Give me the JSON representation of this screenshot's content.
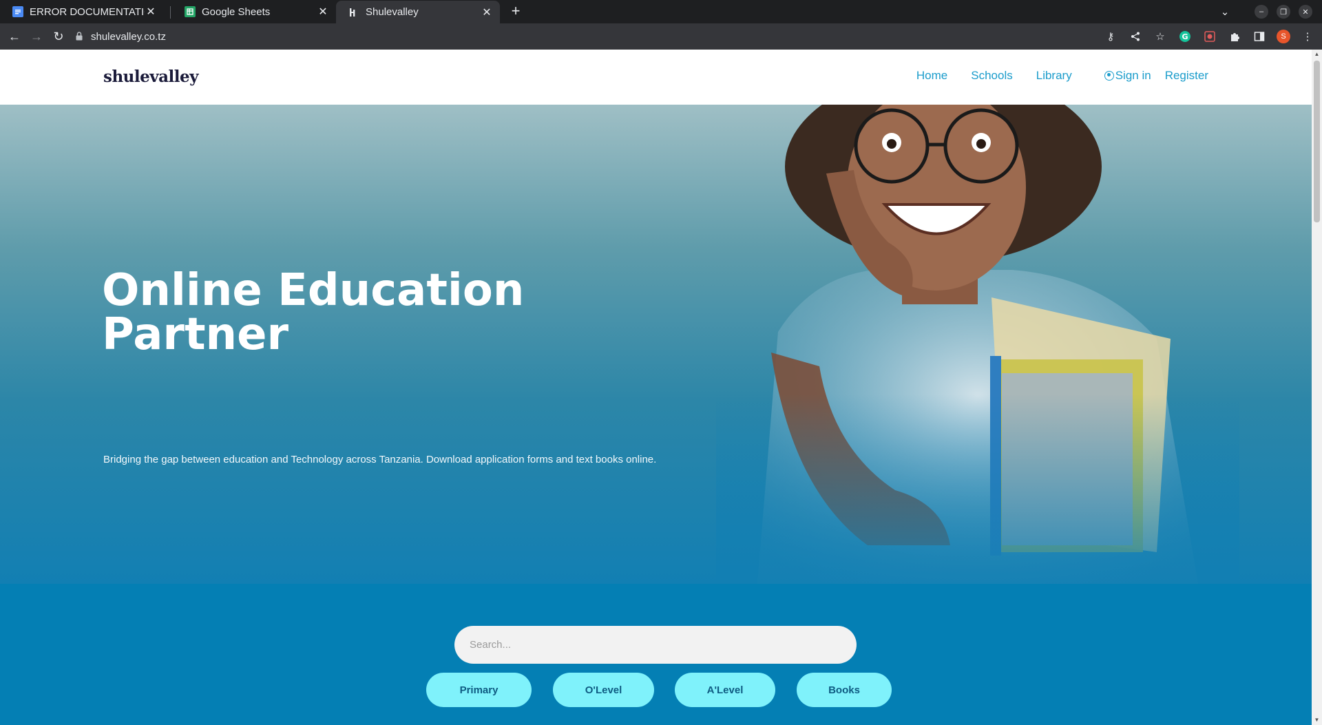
{
  "browser": {
    "tabs": [
      {
        "title": "ERROR DOCUMENTATION"
      },
      {
        "title": "Google Sheets"
      },
      {
        "title": "Shulevalley"
      }
    ],
    "url": "shulevalley.co.tz",
    "profile_initial": "S"
  },
  "site": {
    "brand": "shulevalley",
    "nav": {
      "home": "Home",
      "schools": "Schools",
      "library": "Library",
      "signin": "Sign in",
      "register": "Register"
    }
  },
  "hero": {
    "title_line1": "Online Education",
    "title_line2": "Partner",
    "subtitle": "Bridging the gap between education and Technology across Tanzania. Download application forms and text books online."
  },
  "search": {
    "placeholder": "Search..."
  },
  "categories": [
    "Primary",
    "O'Level",
    "A'Level",
    "Books"
  ],
  "colors": {
    "accent": "#1a9ccb",
    "section_bg": "#047fb4",
    "pill_bg": "#7ff2fb",
    "pill_text": "#0f5b82"
  }
}
